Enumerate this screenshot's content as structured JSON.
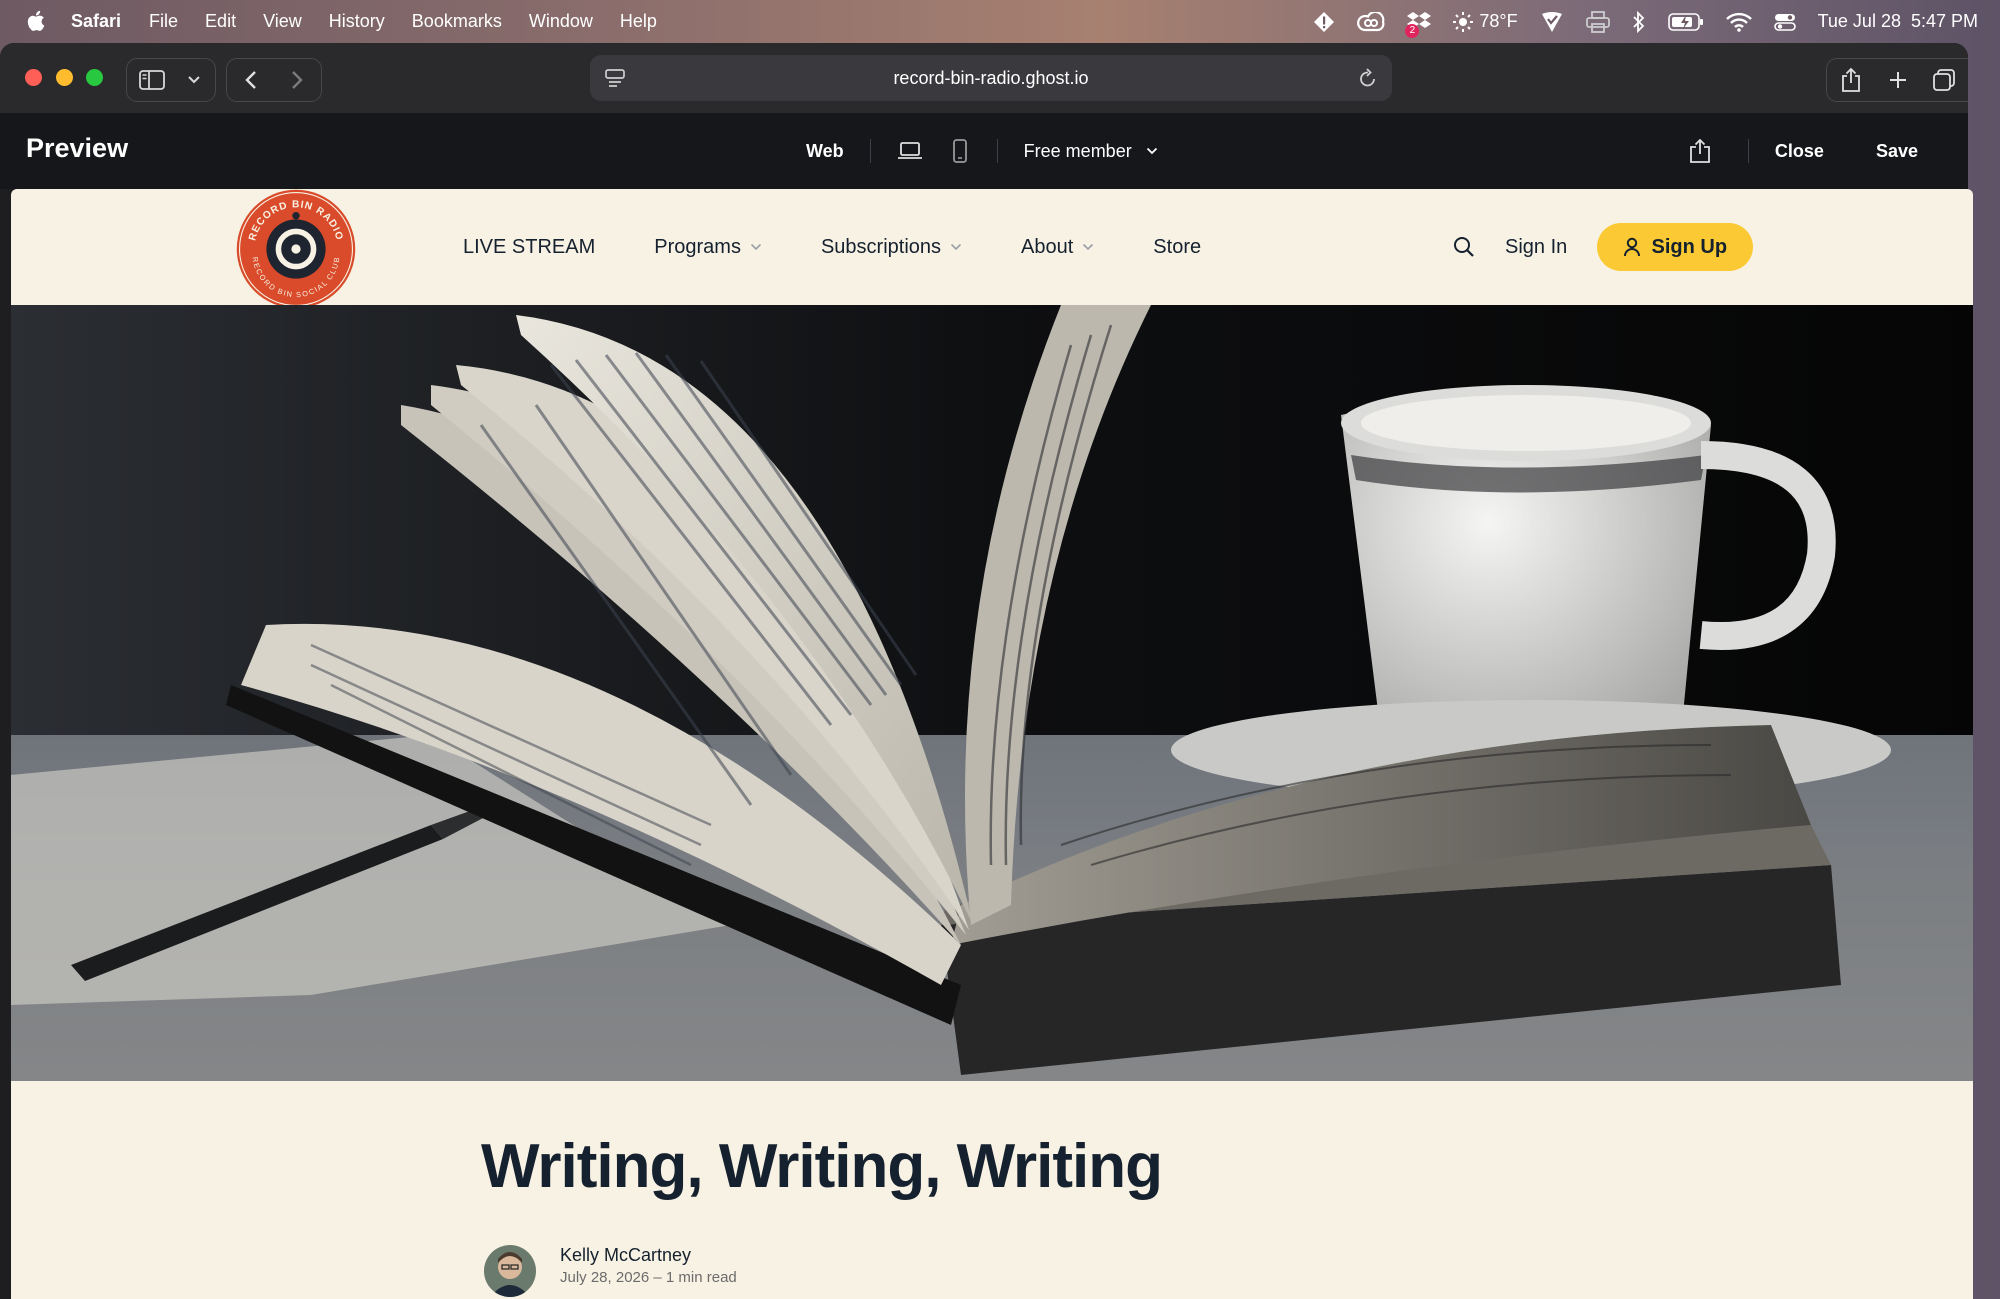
{
  "menubar": {
    "app_name": "Safari",
    "menus": [
      "File",
      "Edit",
      "View",
      "History",
      "Bookmarks",
      "Window",
      "Help"
    ],
    "weather": "78°F",
    "datetime": "Tue Jul 28  5:47 PM",
    "status_icons": [
      "alert-icon",
      "creative-cloud-icon",
      "dropbox-icon",
      "weather-sun-icon",
      "vpn-icon",
      "printer-icon",
      "bluetooth-icon",
      "battery-icon",
      "wifi-icon",
      "control-center-icon"
    ],
    "dropbox_badge": "2"
  },
  "browser": {
    "url": "record-bin-radio.ghost.io"
  },
  "preview_bar": {
    "title": "Preview",
    "web_label": "Web",
    "member_select": "Free member",
    "close_label": "Close",
    "save_label": "Save"
  },
  "site": {
    "logo_top_text": "RECORD BIN RADIO",
    "logo_bottom_text": "RECORD BIN SOCIAL CLUB",
    "nav": [
      {
        "label": "LIVE STREAM",
        "dropdown": false
      },
      {
        "label": "Programs",
        "dropdown": true
      },
      {
        "label": "Subscriptions",
        "dropdown": true
      },
      {
        "label": "About",
        "dropdown": true
      },
      {
        "label": "Store",
        "dropdown": false
      }
    ],
    "sign_in": "Sign In",
    "sign_up": "Sign Up",
    "accent_color": "#fbc933",
    "background_color": "#f8f2e4"
  },
  "post": {
    "title": "Writing, Writing, Writing",
    "author": "Kelly McCartney",
    "meta": "July 28, 2026 – 1 min read"
  }
}
